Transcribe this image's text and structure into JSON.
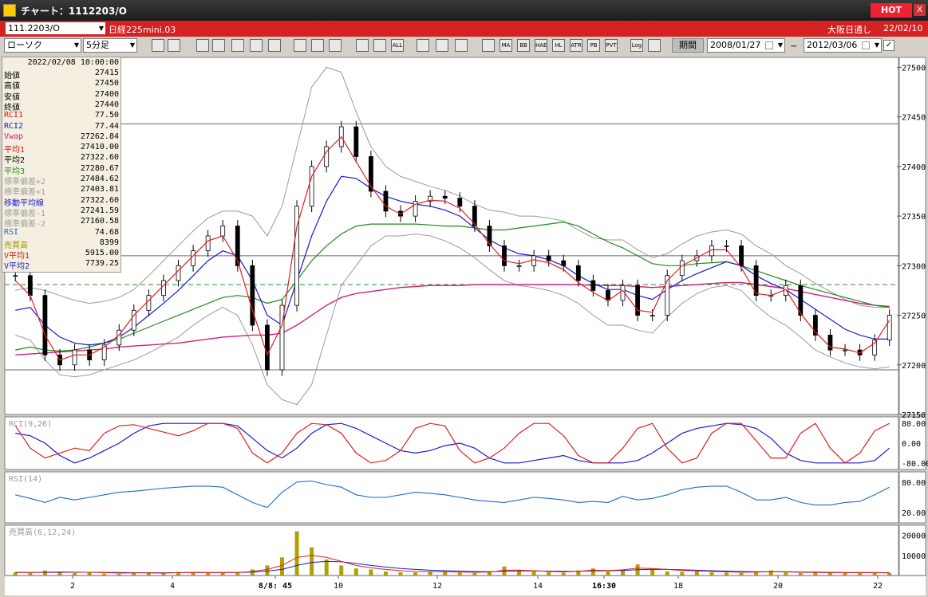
{
  "window": {
    "title": "チャート：1112203/O",
    "hot_badge": "HOT",
    "close_glyph": "X"
  },
  "instrument": {
    "code": "111.2203/O",
    "name": "日経225mini.03",
    "market": "大阪日通し",
    "date": "22/02/10"
  },
  "toolbar": {
    "chart_type": "ローソク",
    "interval": "5分足",
    "period_button": "期間",
    "date_from": "2008/01/27",
    "date_to": "2012/03/06",
    "tilde": "~",
    "icon_buttons": [
      "zoom",
      "lines",
      "draw",
      "magnify",
      "bars",
      "plus-minus",
      "scale",
      "pencil",
      "cursor",
      "undo",
      "candle1",
      "candle2",
      "ALL",
      "gear",
      "palette",
      "colors",
      "grid",
      "MA",
      "BB",
      "HAE",
      "HL",
      "ATR",
      "PB",
      "PVT",
      "Log",
      "export"
    ]
  },
  "colors": {
    "candle_body": "#000000",
    "price_ma_short": "#e02020",
    "price_ma_mid": "#1a1ad0",
    "price_ma_long": "#1e8a1e",
    "vwap": "#d0207a",
    "bollinger": "#9a9a9a",
    "rci1": "#e02020",
    "rci2": "#1a1ad0",
    "rsi": "#1a6ad8",
    "volume": "#b0a000",
    "hline": "#6a6a6a",
    "dashed": "#2e8a2e"
  },
  "info_panel": {
    "timestamp": "2022/02/08  10:00:00",
    "rows": [
      {
        "label": "始値",
        "value": "27415",
        "color": "#000000"
      },
      {
        "label": "高値",
        "value": "27450",
        "color": "#000000"
      },
      {
        "label": "安値",
        "value": "27400",
        "color": "#000000"
      },
      {
        "label": "終値",
        "value": "27440",
        "color": "#000000"
      },
      {
        "label": "RCI1",
        "value": "77.50",
        "color": "#d01818"
      },
      {
        "label": "RCI2",
        "value": "77.44",
        "color": "#1a1ad0"
      },
      {
        "label": "Vwap",
        "value": "27262.84",
        "color": "#d0207a"
      },
      {
        "label": "平均1",
        "value": "27410.00",
        "color": "#d01818"
      },
      {
        "label": "平均2",
        "value": "27322.60",
        "color": "#000000"
      },
      {
        "label": "平均3",
        "value": "27280.67",
        "color": "#1e8a1e"
      },
      {
        "label": "標準偏差+2",
        "value": "27484.62",
        "color": "#a0a0a0"
      },
      {
        "label": "標準偏差+1",
        "value": "27403.81",
        "color": "#a0a0a0"
      },
      {
        "label": "移動平均線",
        "value": "27322.60",
        "color": "#1a1ad0"
      },
      {
        "label": "標準偏差-1",
        "value": "27241.59",
        "color": "#a0a0a0"
      },
      {
        "label": "標準偏差-2",
        "value": "27160.58",
        "color": "#a0a0a0"
      },
      {
        "label": "RSI",
        "value": "74.68",
        "color": "#1a6ad8"
      },
      {
        "label": "売買高",
        "value": "8399",
        "color": "#a09000"
      },
      {
        "label": "V平均1",
        "value": "5915.00",
        "color": "#d01818"
      },
      {
        "label": "V平均2",
        "value": "7739.25",
        "color": "#1a1ad0"
      }
    ]
  },
  "chart_data": [
    {
      "type": "candlestick",
      "ylim": [
        27150,
        27510
      ],
      "y_ticks": [
        "27500",
        "27450",
        "27400",
        "27350",
        "27300",
        "27250",
        "27200",
        "27150"
      ],
      "x_ticks": [
        "2",
        "4",
        "8/8: 45",
        "10",
        "12",
        "14",
        "16:30",
        "18",
        "20",
        "22"
      ],
      "x_tick_bold": [
        false,
        false,
        true,
        false,
        false,
        false,
        true,
        false,
        false,
        false
      ],
      "horizontal_lines": [
        27443,
        27310,
        27195
      ],
      "dashed_line": 27281,
      "close_path": [
        27290,
        27270,
        27210,
        27200,
        27215,
        27205,
        27220,
        27235,
        27255,
        27270,
        27285,
        27300,
        27315,
        27330,
        27340,
        27300,
        27240,
        27195,
        27260,
        27360,
        27400,
        27420,
        27440,
        27410,
        27375,
        27355,
        27350,
        27365,
        27370,
        27368,
        27360,
        27340,
        27320,
        27300,
        27300,
        27310,
        27305,
        27300,
        27285,
        27275,
        27265,
        27280,
        27250,
        27250,
        27290,
        27305,
        27310,
        27320,
        27320,
        27300,
        27270,
        27270,
        27280,
        27250,
        27230,
        27215,
        27215,
        27210,
        27225,
        27250
      ],
      "ma_short": [
        27285,
        27270,
        27230,
        27205,
        27210,
        27210,
        27218,
        27230,
        27250,
        27265,
        27280,
        27295,
        27310,
        27325,
        27330,
        27305,
        27255,
        27210,
        27240,
        27340,
        27390,
        27415,
        27430,
        27405,
        27380,
        27360,
        27352,
        27362,
        27366,
        27365,
        27358,
        27342,
        27322,
        27305,
        27302,
        27306,
        27303,
        27296,
        27283,
        27273,
        27265,
        27275,
        27255,
        27253,
        27285,
        27300,
        27308,
        27316,
        27316,
        27298,
        27272,
        27270,
        27276,
        27252,
        27233,
        27218,
        27216,
        27212,
        27222,
        27245
      ],
      "ma_mid": [
        27255,
        27258,
        27240,
        27228,
        27222,
        27220,
        27222,
        27228,
        27238,
        27250,
        27262,
        27275,
        27290,
        27305,
        27315,
        27310,
        27285,
        27250,
        27240,
        27285,
        27330,
        27365,
        27390,
        27388,
        27378,
        27370,
        27365,
        27362,
        27360,
        27356,
        27350,
        27338,
        27326,
        27318,
        27312,
        27310,
        27306,
        27300,
        27290,
        27282,
        27276,
        27276,
        27270,
        27266,
        27276,
        27285,
        27292,
        27298,
        27304,
        27300,
        27290,
        27282,
        27276,
        27266,
        27256,
        27246,
        27236,
        27230,
        27226,
        27226
      ],
      "ma_long": [
        27215,
        27218,
        27215,
        27214,
        27215,
        27218,
        27222,
        27226,
        27232,
        27238,
        27244,
        27250,
        27256,
        27262,
        27268,
        27270,
        27268,
        27262,
        27266,
        27285,
        27305,
        27320,
        27332,
        27340,
        27342,
        27342,
        27342,
        27342,
        27341,
        27340,
        27340,
        27338,
        27336,
        27336,
        27338,
        27340,
        27342,
        27344,
        27340,
        27332,
        27324,
        27318,
        27310,
        27302,
        27300,
        27300,
        27302,
        27303,
        27304,
        27300,
        27295,
        27290,
        27285,
        27280,
        27276,
        27272,
        27268,
        27264,
        27260,
        27258
      ],
      "vwap": [
        27210,
        27211,
        27212,
        27213,
        27214,
        27215,
        27216,
        27218,
        27219,
        27220,
        27221,
        27222,
        27224,
        27226,
        27228,
        27229,
        27230,
        27230,
        27232,
        27240,
        27250,
        27260,
        27268,
        27272,
        27274,
        27276,
        27278,
        27279,
        27280,
        27280,
        27280,
        27281,
        27281,
        27281,
        27281,
        27281,
        27281,
        27281,
        27281,
        27280,
        27280,
        27280,
        27279,
        27278,
        27279,
        27280,
        27281,
        27282,
        27283,
        27283,
        27281,
        27279,
        27277,
        27274,
        27271,
        27268,
        27265,
        27262,
        27260,
        27259
      ],
      "bb_upper": [
        27275,
        27278,
        27275,
        27270,
        27265,
        27262,
        27264,
        27268,
        27276,
        27290,
        27305,
        27320,
        27335,
        27348,
        27355,
        27355,
        27350,
        27330,
        27360,
        27420,
        27480,
        27500,
        27495,
        27455,
        27420,
        27400,
        27390,
        27385,
        27380,
        27376,
        27370,
        27362,
        27356,
        27354,
        27350,
        27350,
        27348,
        27345,
        27336,
        27328,
        27326,
        27326,
        27316,
        27308,
        27312,
        27322,
        27330,
        27334,
        27336,
        27332,
        27320,
        27312,
        27300,
        27292,
        27282,
        27274,
        27266,
        27260,
        27258,
        27258
      ],
      "bb_lower": [
        27230,
        27225,
        27205,
        27190,
        27188,
        27190,
        27195,
        27200,
        27205,
        27212,
        27220,
        27228,
        27240,
        27250,
        27258,
        27250,
        27220,
        27180,
        27165,
        27160,
        27180,
        27230,
        27280,
        27300,
        27320,
        27330,
        27330,
        27332,
        27330,
        27325,
        27318,
        27308,
        27296,
        27285,
        27280,
        27278,
        27275,
        27270,
        27262,
        27250,
        27240,
        27240,
        27235,
        27232,
        27248,
        27262,
        27272,
        27278,
        27280,
        27275,
        27260,
        27248,
        27240,
        27228,
        27215,
        27208,
        27202,
        27198,
        27196,
        27198
      ],
      "rci_ylim": [
        -100,
        100
      ],
      "rci_ticks": [
        "80.00",
        "0.00",
        "-80.00"
      ],
      "rci1": [
        70,
        -20,
        -60,
        -40,
        -20,
        -30,
        40,
        70,
        75,
        60,
        45,
        30,
        50,
        80,
        80,
        60,
        -40,
        -80,
        -40,
        40,
        80,
        75,
        40,
        -40,
        -80,
        -70,
        -30,
        60,
        80,
        70,
        -30,
        -80,
        -60,
        -20,
        40,
        80,
        80,
        30,
        -50,
        -80,
        -80,
        -20,
        60,
        80,
        -20,
        -80,
        -60,
        40,
        80,
        80,
        10,
        -60,
        -60,
        40,
        80,
        -20,
        -80,
        -40,
        50,
        80
      ],
      "rci2": [
        40,
        30,
        0,
        -50,
        -80,
        -60,
        -30,
        0,
        40,
        70,
        80,
        80,
        80,
        80,
        80,
        70,
        20,
        -30,
        -60,
        -20,
        40,
        75,
        80,
        60,
        30,
        0,
        -30,
        -40,
        -30,
        -10,
        0,
        -20,
        -60,
        -80,
        -80,
        -70,
        -60,
        -50,
        -70,
        -80,
        -80,
        -80,
        -70,
        -40,
        0,
        40,
        60,
        70,
        80,
        75,
        60,
        20,
        -40,
        -70,
        -80,
        -80,
        -80,
        -80,
        -70,
        -20
      ],
      "rsi_ylim": [
        0,
        100
      ],
      "rsi_ticks": [
        "80.00",
        "20.00"
      ],
      "rsi": [
        55,
        48,
        40,
        50,
        45,
        50,
        55,
        60,
        62,
        65,
        68,
        70,
        72,
        72,
        70,
        55,
        40,
        30,
        60,
        80,
        82,
        75,
        70,
        55,
        50,
        50,
        55,
        60,
        58,
        55,
        50,
        45,
        42,
        40,
        45,
        50,
        48,
        45,
        40,
        42,
        40,
        52,
        45,
        48,
        55,
        65,
        70,
        72,
        72,
        60,
        45,
        45,
        50,
        40,
        35,
        35,
        40,
        42,
        55,
        70
      ],
      "vol_ylim": [
        0,
        25000
      ],
      "vol_ticks": [
        "20000",
        "10000"
      ],
      "volume": [
        1500,
        1200,
        2500,
        1800,
        1200,
        1500,
        1000,
        800,
        1500,
        1200,
        1000,
        1800,
        1500,
        1200,
        1500,
        1600,
        3000,
        5000,
        9000,
        22000,
        14000,
        8000,
        5000,
        3500,
        3000,
        2000,
        1600,
        1500,
        1800,
        2000,
        1400,
        1200,
        2000,
        4500,
        2500,
        2000,
        1600,
        1400,
        2500,
        3500,
        2000,
        3000,
        5500,
        2800,
        2000,
        1800,
        2200,
        1500,
        1400,
        1200,
        1800,
        2500,
        1500,
        1200,
        1400,
        1200,
        1600,
        1500,
        1300,
        1200
      ],
      "vol_ma1": [
        1600,
        1500,
        1700,
        1800,
        1700,
        1600,
        1400,
        1200,
        1300,
        1300,
        1200,
        1400,
        1500,
        1400,
        1400,
        1500,
        2000,
        3000,
        5000,
        9000,
        10000,
        9000,
        7000,
        5000,
        3800,
        3000,
        2400,
        2000,
        1900,
        1900,
        1700,
        1600,
        1700,
        2600,
        2700,
        2400,
        2000,
        1800,
        2100,
        2700,
        2500,
        2800,
        3700,
        3500,
        3000,
        2500,
        2300,
        2000,
        1800,
        1600,
        1700,
        1900,
        1800,
        1600,
        1500,
        1400,
        1400,
        1400,
        1400,
        1300
      ],
      "vol_ma2": [
        1500,
        1500,
        1550,
        1600,
        1600,
        1600,
        1550,
        1450,
        1400,
        1400,
        1350,
        1400,
        1450,
        1450,
        1450,
        1500,
        1700,
        2200,
        3000,
        5000,
        6500,
        7000,
        6800,
        6000,
        5000,
        4200,
        3500,
        3000,
        2600,
        2400,
        2200,
        2000,
        1900,
        2100,
        2300,
        2300,
        2200,
        2100,
        2100,
        2300,
        2400,
        2500,
        2900,
        3100,
        3000,
        2800,
        2600,
        2400,
        2200,
        2000,
        1900,
        1900,
        1850,
        1750,
        1650,
        1550,
        1500,
        1450,
        1450,
        1400
      ],
      "panel_labels": {
        "rci": "RCI(9,26)",
        "rsi": "RSI(14)",
        "vol": "売買高(6,12,24)"
      }
    }
  ]
}
